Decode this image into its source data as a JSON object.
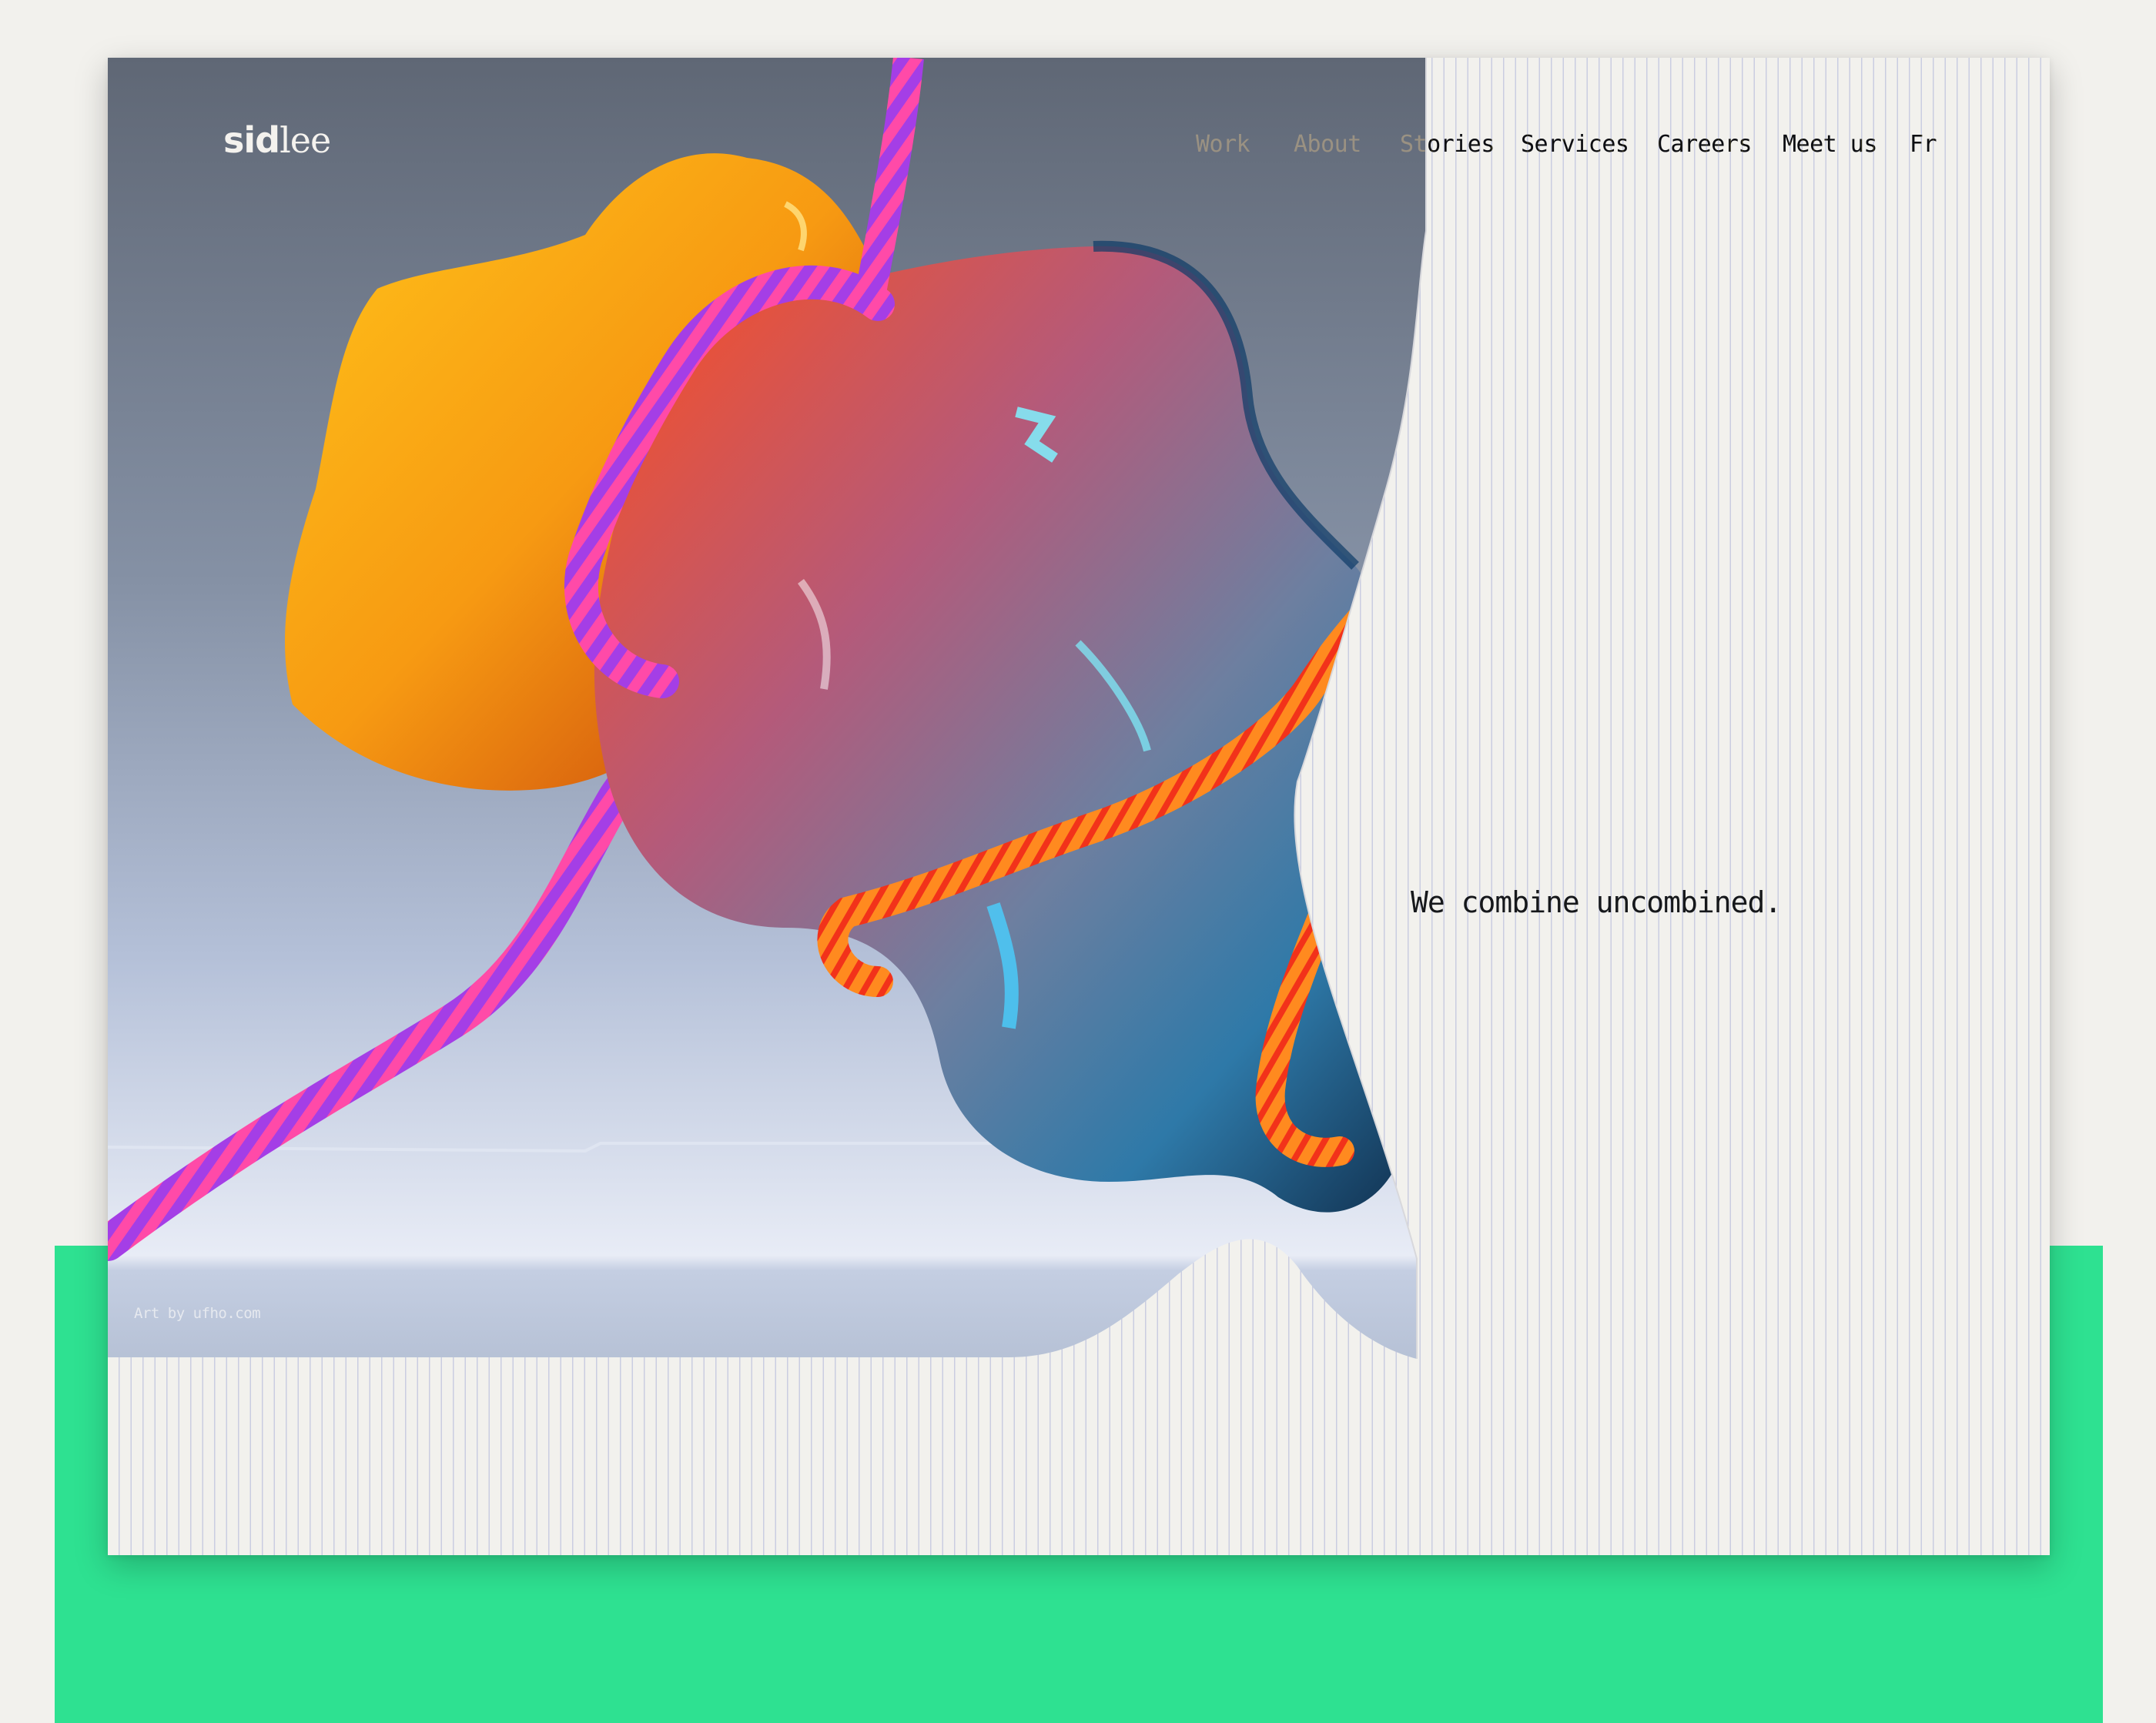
{
  "brand": {
    "logo_part1": "sid",
    "logo_part2": "lee"
  },
  "nav": {
    "items": [
      {
        "label": "Work"
      },
      {
        "label": "About"
      },
      {
        "label": "Stories"
      },
      {
        "label": "Services"
      },
      {
        "label": "Careers"
      },
      {
        "label": "Meet us"
      },
      {
        "label": "Fr"
      }
    ]
  },
  "hero": {
    "tagline": "We combine uncombined.",
    "art_credit": "Art by ufho.com"
  },
  "colors": {
    "page_background": "#f2f1ed",
    "accent_green": "#2ee191",
    "text_dark": "#16181b",
    "sky_top": "#5f6775",
    "sky_bottom": "#e8ecf6"
  }
}
